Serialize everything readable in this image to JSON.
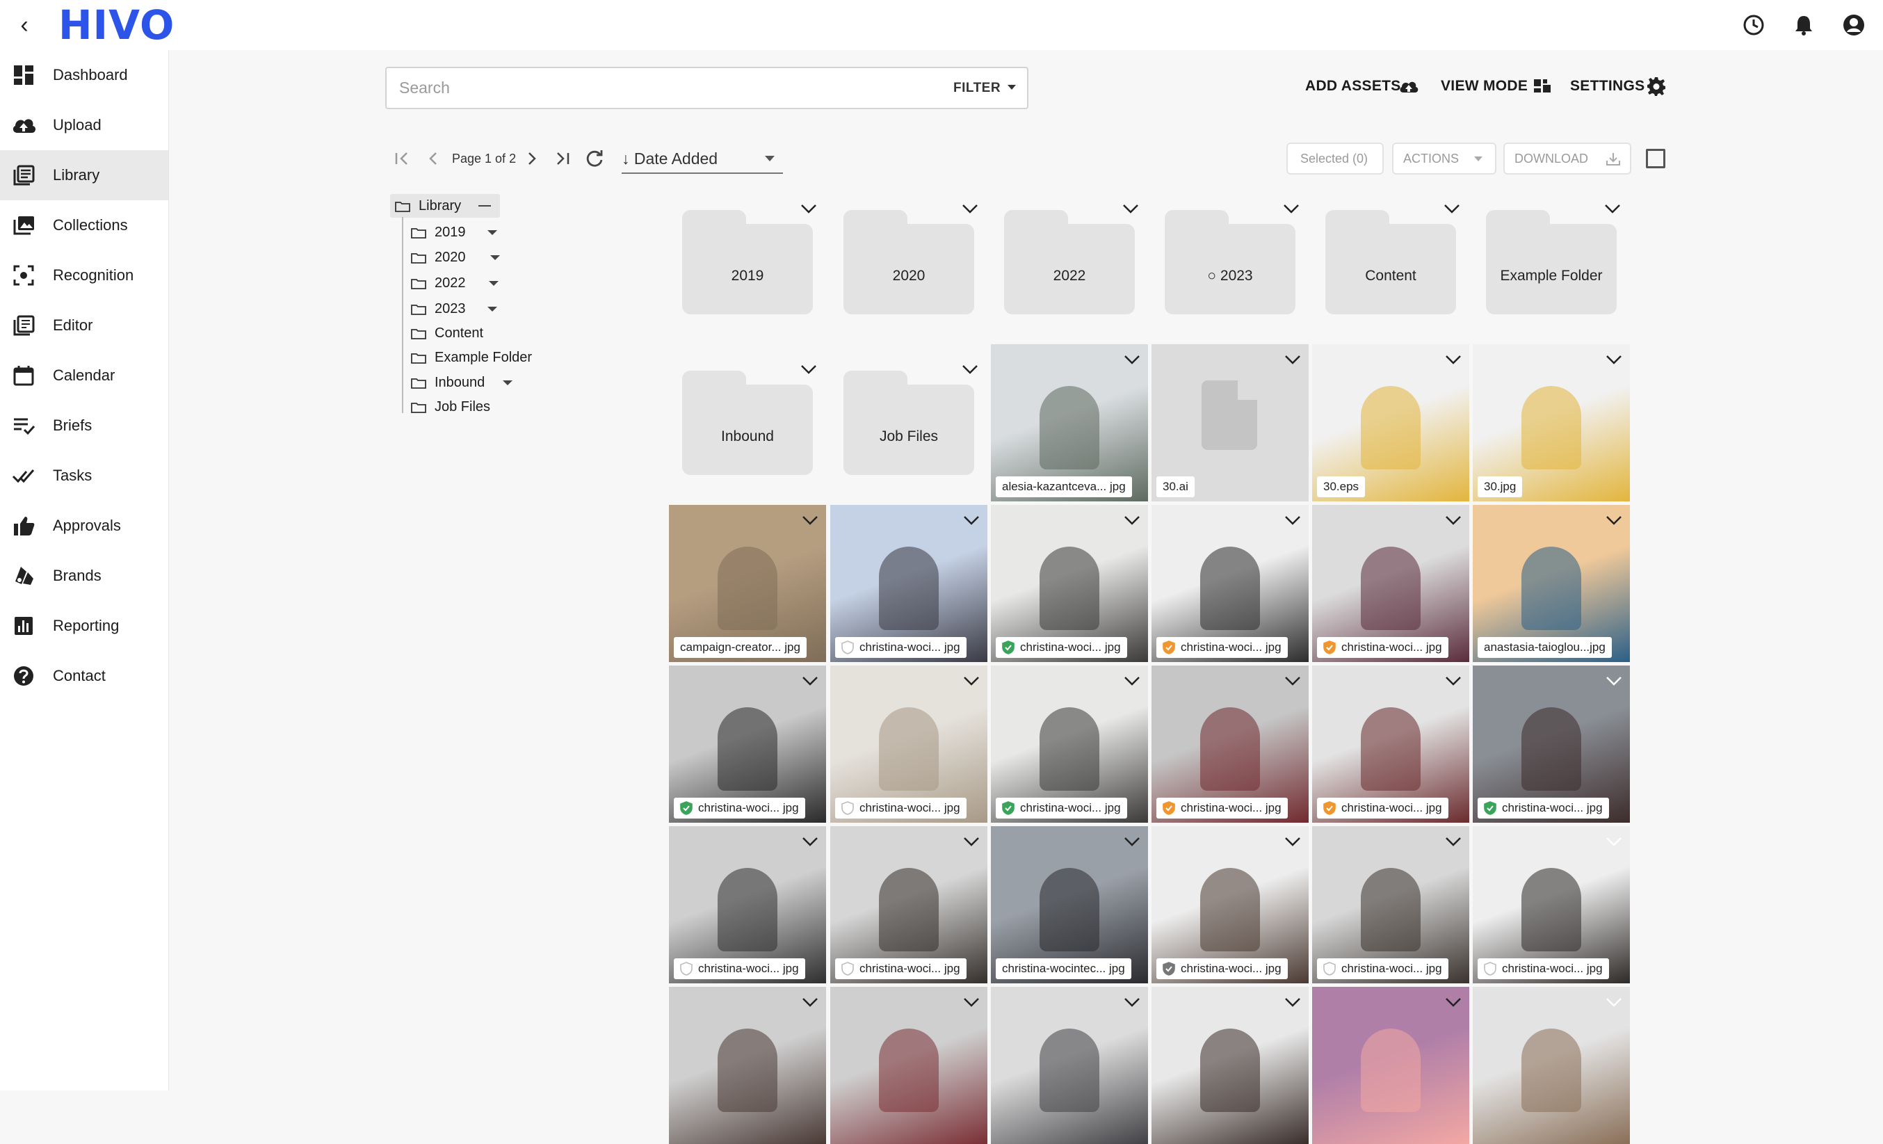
{
  "header": {
    "logo": "HIVO",
    "back_icon": "chevron-left-icon",
    "icons": [
      "history-icon",
      "bell-icon",
      "account-icon"
    ]
  },
  "sidebar": {
    "items": [
      {
        "label": "Dashboard",
        "icon": "dashboard-icon"
      },
      {
        "label": "Upload",
        "icon": "cloud-upload-icon"
      },
      {
        "label": "Library",
        "icon": "library-icon",
        "active": true
      },
      {
        "label": "Collections",
        "icon": "collections-icon"
      },
      {
        "label": "Recognition",
        "icon": "recognition-icon"
      },
      {
        "label": "Editor",
        "icon": "editor-icon"
      },
      {
        "label": "Calendar",
        "icon": "calendar-icon"
      },
      {
        "label": "Briefs",
        "icon": "briefs-icon"
      },
      {
        "label": "Tasks",
        "icon": "tasks-icon"
      },
      {
        "label": "Approvals",
        "icon": "thumbs-up-icon"
      },
      {
        "label": "Brands",
        "icon": "brands-icon"
      },
      {
        "label": "Reporting",
        "icon": "reporting-icon"
      },
      {
        "label": "Contact",
        "icon": "help-icon"
      }
    ]
  },
  "toolbar": {
    "search_placeholder": "Search",
    "filter_label": "FILTER",
    "add_assets": "ADD ASSETS",
    "view_mode": "VIEW MODE",
    "settings": "SETTINGS"
  },
  "pager": {
    "page_text": "Page 1 of 2",
    "sort_label": "↓ Date Added",
    "selected": "Selected (0)",
    "actions": "ACTIONS",
    "download": "DOWNLOAD"
  },
  "tree": {
    "root": "Library",
    "children": [
      {
        "label": "2019",
        "expandable": true
      },
      {
        "label": "2020",
        "expandable": true
      },
      {
        "label": "2022",
        "expandable": true
      },
      {
        "label": "2023",
        "expandable": true
      },
      {
        "label": "Content",
        "expandable": false
      },
      {
        "label": "Example Folder",
        "expandable": false
      },
      {
        "label": "Inbound",
        "expandable": true
      },
      {
        "label": "Job Files",
        "expandable": false
      }
    ]
  },
  "folders": [
    "2019",
    "2020",
    "2022",
    "2023",
    "Content",
    "Example Folder",
    "Inbound",
    "Job Files"
  ],
  "assets": [
    {
      "name": "alesia-kazantceva... jpg",
      "status": "none",
      "colors": [
        "#d9dde0",
        "#5e6a60"
      ]
    },
    {
      "name": "30.ai",
      "status": "none",
      "file": true,
      "colors": [
        "#dcdcdc",
        "#dcdcdc"
      ]
    },
    {
      "name": "30.eps",
      "status": "none",
      "colors": [
        "#f1f1f1",
        "#e2b53d"
      ]
    },
    {
      "name": "30.jpg",
      "status": "none",
      "colors": [
        "#f1f1f1",
        "#e2b53d"
      ]
    },
    {
      "name": "campaign-creator... jpg",
      "status": "none",
      "colors": [
        "#b59d80",
        "#7f6d58"
      ]
    },
    {
      "name": "christina-woci... jpg",
      "status": "grey",
      "colors": [
        "#c5d1e5",
        "#3a3a44"
      ]
    },
    {
      "name": "christina-woci... jpg",
      "status": "green",
      "colors": [
        "#e8e8e6",
        "#3b3a38"
      ]
    },
    {
      "name": "christina-woci... jpg",
      "status": "orange",
      "colors": [
        "#eeeeee",
        "#2d2d2d"
      ]
    },
    {
      "name": "christina-woci... jpg",
      "status": "orange",
      "colors": [
        "#dcdcdc",
        "#5a2c3c"
      ]
    },
    {
      "name": "anastasia-taioglou...jpg",
      "status": "none",
      "colors": [
        "#f0c99a",
        "#2c5f87"
      ]
    },
    {
      "name": "christina-woci... jpg",
      "status": "green",
      "colors": [
        "#c9c9c9",
        "#2a2a2a"
      ]
    },
    {
      "name": "christina-woci... jpg",
      "status": "grey",
      "colors": [
        "#e5e2dc",
        "#a89986"
      ]
    },
    {
      "name": "christina-woci... jpg",
      "status": "green",
      "colors": [
        "#e8e8e6",
        "#3b3a38"
      ]
    },
    {
      "name": "christina-woci... jpg",
      "status": "orange",
      "colors": [
        "#c6c6c6",
        "#712a2f"
      ]
    },
    {
      "name": "christina-woci... jpg",
      "status": "orange",
      "colors": [
        "#e3e3e3",
        "#6a2b2e"
      ]
    },
    {
      "name": "christina-woci... jpg",
      "status": "green",
      "colors": [
        "#8a8f95",
        "#3d2c2c"
      ]
    },
    {
      "name": "christina-woci... jpg",
      "status": "grey",
      "colors": [
        "#cfcfcf",
        "#2f2f2f"
      ]
    },
    {
      "name": "christina-woci... jpg",
      "status": "grey",
      "colors": [
        "#d6d6d6",
        "#35302c"
      ]
    },
    {
      "name": "christina-wocintec... jpg",
      "status": "none",
      "colors": [
        "#9aa0a8",
        "#2a2a2e"
      ]
    },
    {
      "name": "christina-woci... jpg",
      "status": "shield-dark",
      "colors": [
        "#ededed",
        "#4b3a32"
      ]
    },
    {
      "name": "christina-woci... jpg",
      "status": "grey",
      "colors": [
        "#d7d7d7",
        "#3a332e"
      ]
    },
    {
      "name": "christina-woci... jpg",
      "status": "grey",
      "colors": [
        "#eeeeee",
        "#2e2a28"
      ]
    },
    {
      "name": "",
      "status": "none",
      "colors": [
        "#cfcfcf",
        "#4a3a35"
      ]
    },
    {
      "name": "",
      "status": "none",
      "colors": [
        "#cfcfcf",
        "#7a2f35"
      ]
    },
    {
      "name": "",
      "status": "none",
      "colors": [
        "#dcdcdc",
        "#424246"
      ]
    },
    {
      "name": "",
      "status": "none",
      "colors": [
        "#e8e8e8",
        "#3a2e2a"
      ]
    },
    {
      "name": "",
      "status": "none",
      "colors": [
        "#b07fa8",
        "#f3a8a3"
      ]
    },
    {
      "name": "",
      "status": "none",
      "colors": [
        "#e3e3e3",
        "#8a6f58"
      ]
    }
  ],
  "colors": {
    "brand": "#2d54e8",
    "status_green": "#3aa45a",
    "status_orange": "#f0962f",
    "status_grey": "#bdbdbd"
  }
}
